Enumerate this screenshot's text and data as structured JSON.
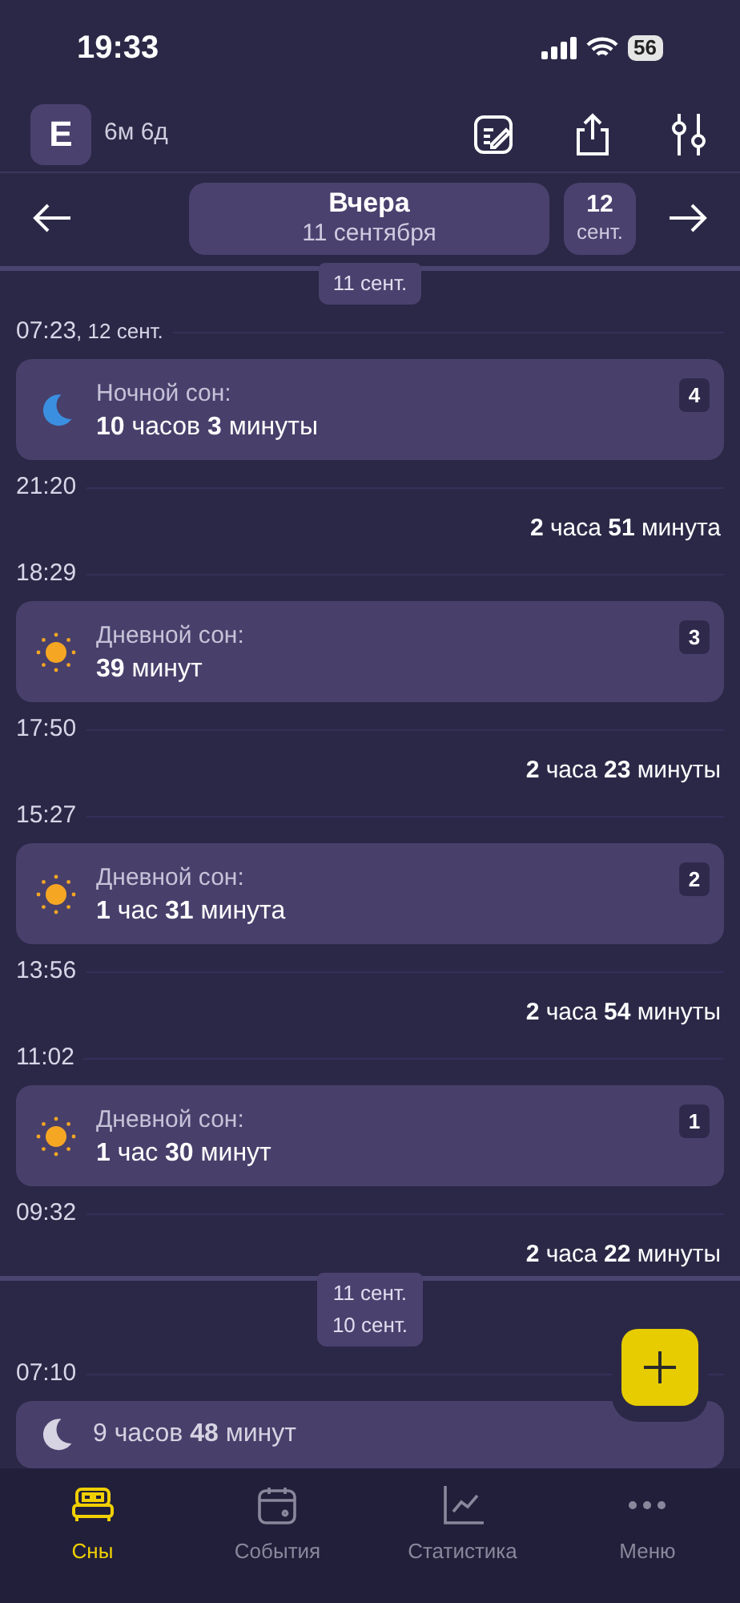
{
  "status_bar": {
    "time": "19:33",
    "battery": "56"
  },
  "header": {
    "avatar": "E",
    "age": "6м 6д"
  },
  "date_nav": {
    "title": "Вчера",
    "subtitle": "11 сентября",
    "next_day": "12",
    "next_month": "сент."
  },
  "timeline": [
    {
      "kind": "divider",
      "labels": [
        "11 сент."
      ]
    },
    {
      "kind": "time",
      "time": "07:23",
      "note": ", 12 сент."
    },
    {
      "kind": "night_sleep",
      "label": "Ночной сон:",
      "duration": "**10** часов **3** минуты",
      "number": "4"
    },
    {
      "kind": "time",
      "time": "21:20"
    },
    {
      "kind": "gap",
      "duration": "**2** часа **51** минута"
    },
    {
      "kind": "time",
      "time": "18:29"
    },
    {
      "kind": "day_sleep",
      "label": "Дневной сон:",
      "duration": "**39** минут",
      "number": "3"
    },
    {
      "kind": "time",
      "time": "17:50"
    },
    {
      "kind": "gap",
      "duration": "**2** часа **23** минуты"
    },
    {
      "kind": "time",
      "time": "15:27"
    },
    {
      "kind": "day_sleep",
      "label": "Дневной сон:",
      "duration": "**1** час **31** минута",
      "number": "2"
    },
    {
      "kind": "time",
      "time": "13:56"
    },
    {
      "kind": "gap",
      "duration": "**2** часа **54** минуты"
    },
    {
      "kind": "time",
      "time": "11:02"
    },
    {
      "kind": "day_sleep",
      "label": "Дневной сон:",
      "duration": "**1** час **30** минут",
      "number": "1"
    },
    {
      "kind": "time",
      "time": "09:32"
    },
    {
      "kind": "gap",
      "duration": "**2** часа **22** минуты"
    },
    {
      "kind": "divider",
      "labels": [
        "11 сент.",
        "10 сент."
      ]
    },
    {
      "kind": "time",
      "time": "07:10"
    },
    {
      "kind": "summary",
      "duration": "9 часов **48** минут"
    }
  ],
  "tabs": [
    {
      "label": "Сны",
      "selected": true
    },
    {
      "label": "События",
      "selected": false
    },
    {
      "label": "Статистика",
      "selected": false
    },
    {
      "label": "Меню",
      "selected": false
    }
  ]
}
